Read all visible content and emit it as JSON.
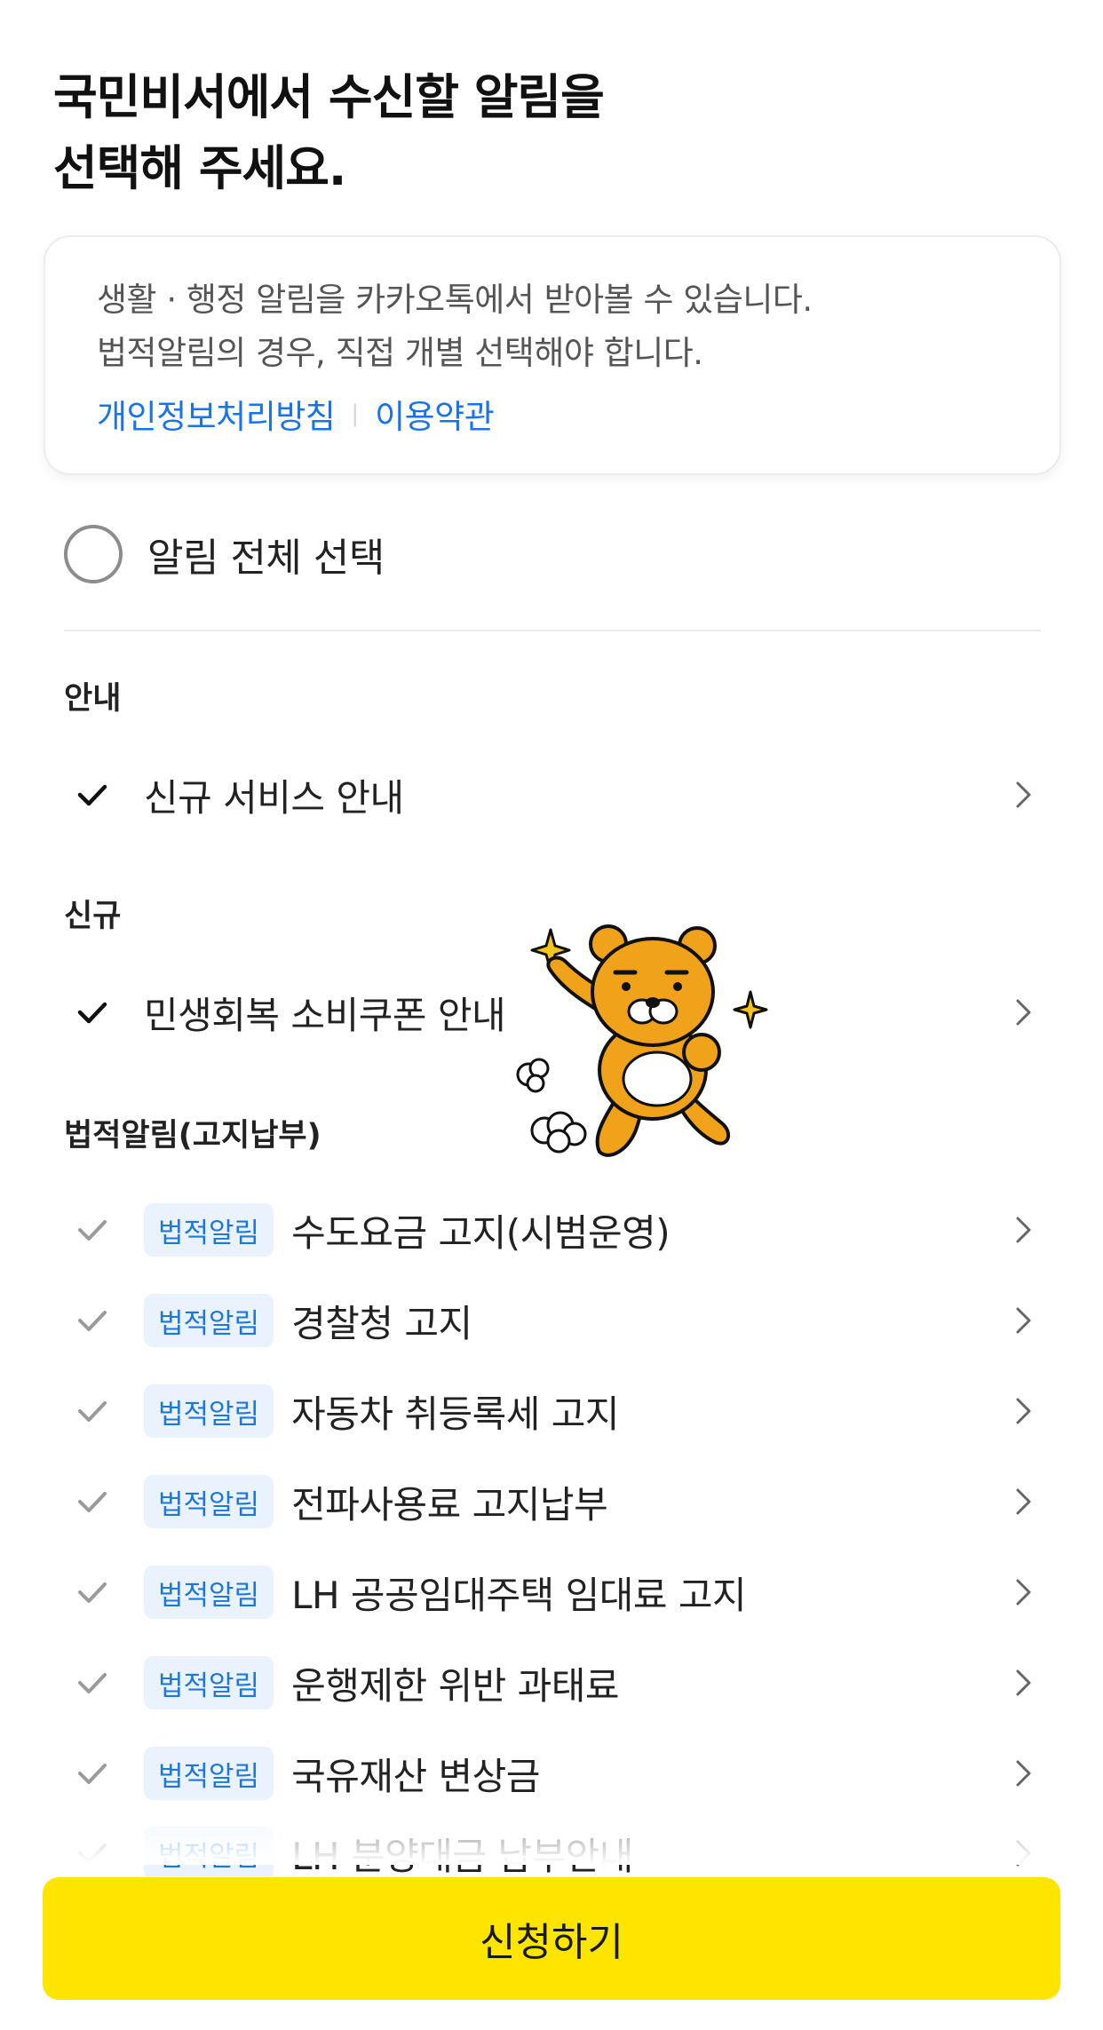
{
  "title": {
    "line1": "국민비서에서 수신할 알림을",
    "line2": "선택해 주세요."
  },
  "info": {
    "line1": "생활 · 행정 알림을 카카오톡에서 받아볼 수 있습니다.",
    "line2": "법적알림의 경우, 직접 개별 선택해야 합니다.",
    "privacy_link": "개인정보처리방침",
    "terms_link": "이용약관"
  },
  "select_all": {
    "label": "알림 전체 선택",
    "checked": false
  },
  "sections": [
    {
      "title": "안내",
      "items": [
        {
          "label": "신규 서비스 안내"
        }
      ]
    },
    {
      "title": "신규",
      "items": [
        {
          "label": "민생회복 소비쿠폰 안내"
        }
      ]
    },
    {
      "title": "법적알림(고지납부)",
      "items": [
        {
          "badge": "법적알림",
          "label": "수도요금 고지(시범운영)"
        },
        {
          "badge": "법적알림",
          "label": "경찰청 고지"
        },
        {
          "badge": "법적알림",
          "label": "자동차 취등록세 고지"
        },
        {
          "badge": "법적알림",
          "label": "전파사용료 고지납부"
        },
        {
          "badge": "법적알림",
          "label": "LH 공공임대주택 임대료 고지"
        },
        {
          "badge": "법적알림",
          "label": "운행제한 위반 과태료"
        },
        {
          "badge": "법적알림",
          "label": "국유재산 변상금"
        },
        {
          "badge": "법적알림",
          "label": "LH 분양대금 납부안내"
        }
      ]
    }
  ],
  "submit_label": "신청하기",
  "colors": {
    "accent_yellow": "#fee500",
    "link_blue": "#1a73e8",
    "badge_bg": "#eaf3fd",
    "badge_text": "#1f78d6",
    "check_dark": "#111111",
    "check_light": "#9a9a9a"
  },
  "icons": {
    "check": "check-icon",
    "chevron": "chevron-right-icon",
    "mascot": "ryan-mascot-sticker"
  }
}
